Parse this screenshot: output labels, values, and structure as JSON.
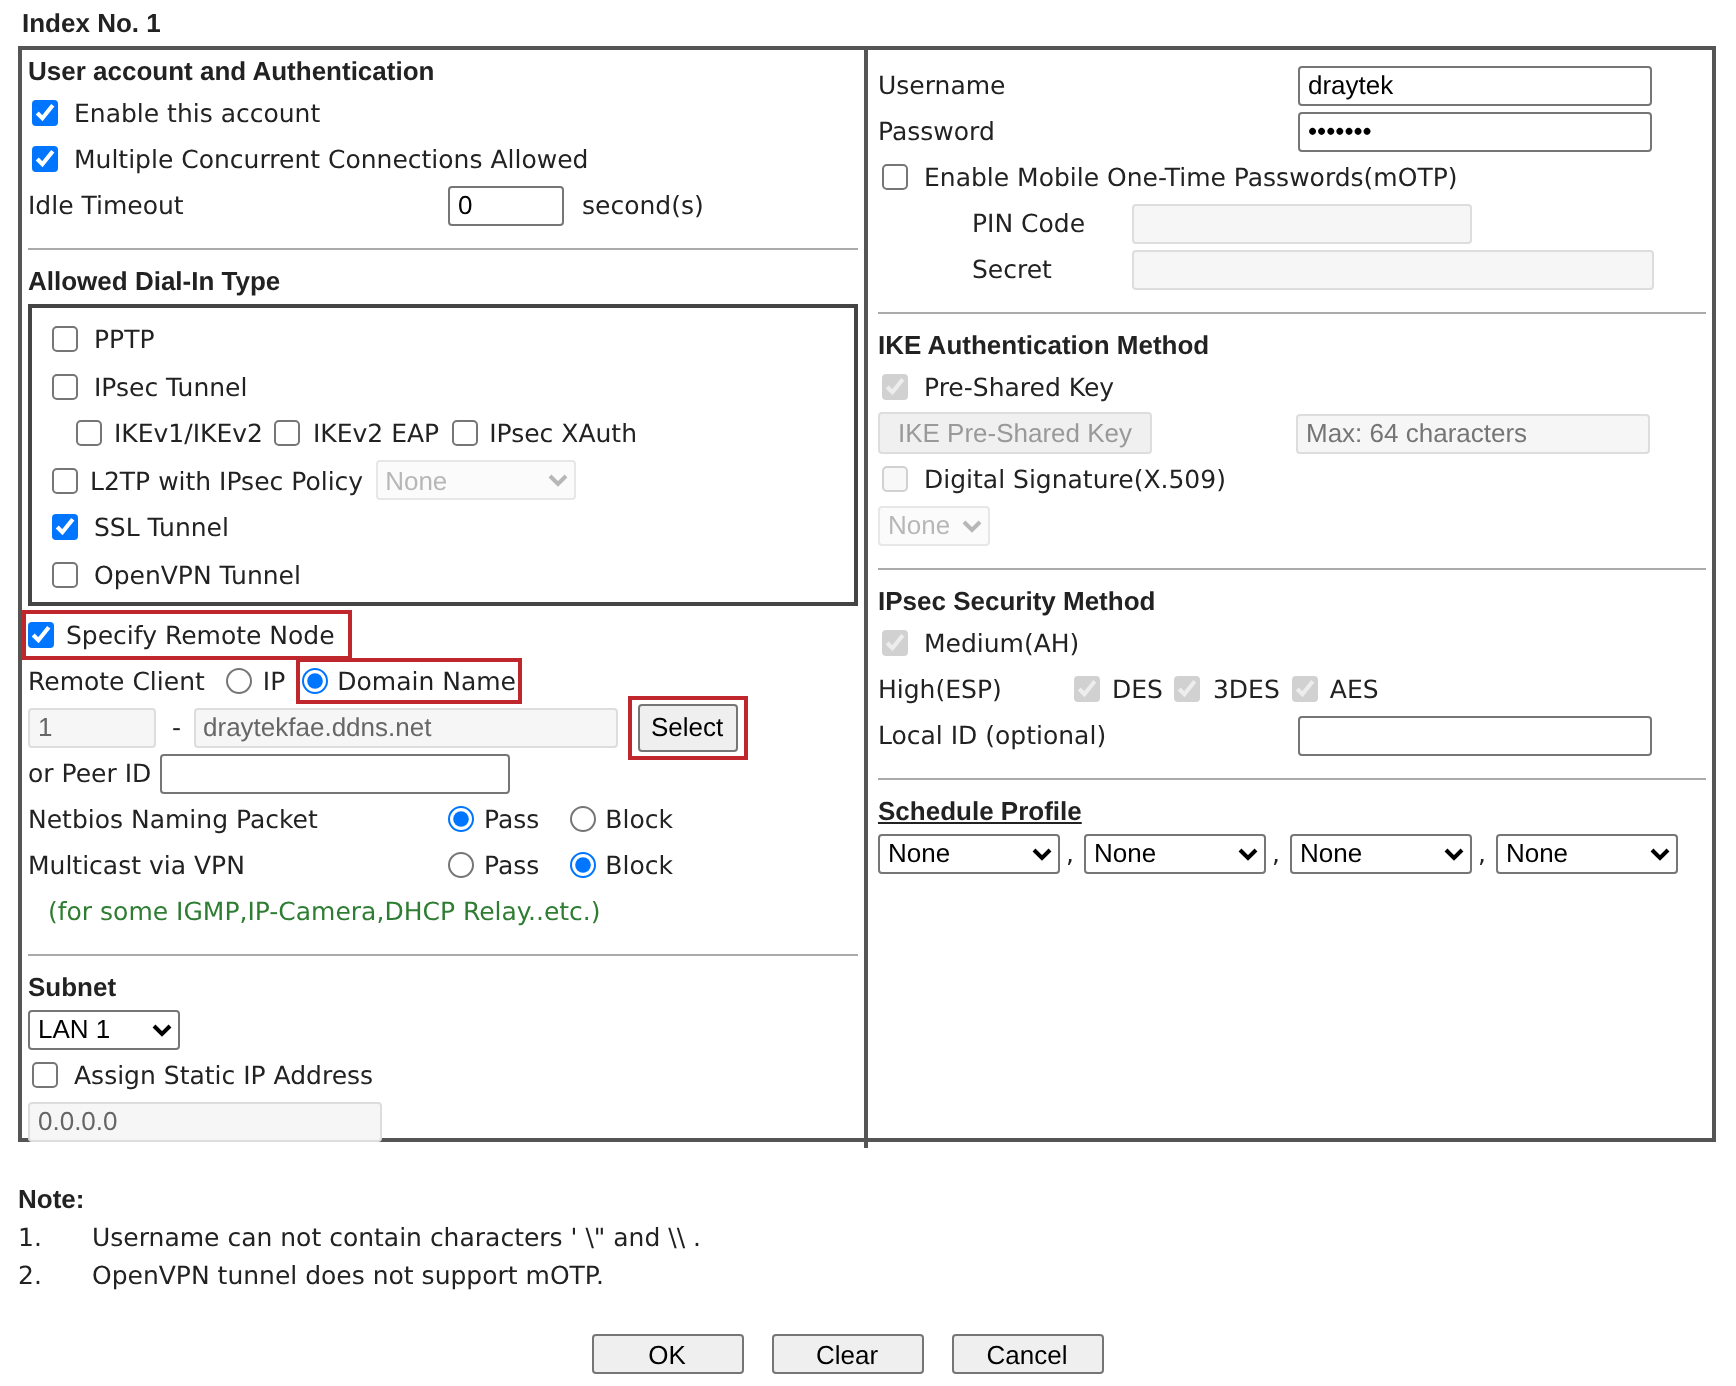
{
  "index_title": "Index No. 1",
  "account": {
    "heading": "User account and Authentication",
    "options": [
      {
        "label": "Enable this account",
        "checked": true
      },
      {
        "label": "Multiple Concurrent Connections Allowed",
        "checked": true
      }
    ],
    "idle_timeout": {
      "label": "Idle Timeout",
      "value": "0",
      "unit": "second(s)"
    }
  },
  "dial_in": {
    "heading": "Allowed Dial-In Type",
    "items": [
      {
        "kind": "check",
        "label": "PPTP",
        "checked": false
      },
      {
        "kind": "check",
        "label": "IPsec Tunnel",
        "checked": false
      },
      {
        "kind": "subchecks",
        "options": [
          {
            "label": "IKEv1/IKEv2",
            "checked": false
          },
          {
            "label": "IKEv2 EAP",
            "checked": false
          },
          {
            "label": "IPsec XAuth",
            "checked": false
          }
        ]
      },
      {
        "kind": "check_select",
        "label": "L2TP with IPsec Policy",
        "checked": false,
        "select": "None",
        "disabled": true
      },
      {
        "kind": "check",
        "label": "SSL Tunnel",
        "checked": true
      },
      {
        "kind": "check",
        "label": "OpenVPN Tunnel",
        "checked": false
      }
    ]
  },
  "remote_node": {
    "label": "Specify Remote Node",
    "checked": true,
    "highlighted": true
  },
  "remote_client": {
    "label": "Remote Client",
    "options": [
      {
        "label": "IP",
        "selected": false,
        "highlighted": false
      },
      {
        "label": "Domain Name",
        "selected": true,
        "highlighted": true
      }
    ],
    "index_value": "1",
    "separator": "-",
    "domain_value": "draytekfae.ddns.net",
    "select_button": {
      "label": "Select",
      "highlighted": true
    }
  },
  "peer_id": {
    "label": "or Peer ID"
  },
  "radio_rows": [
    {
      "label": "Netbios Naming Packet",
      "options": [
        {
          "label": "Pass",
          "selected": true
        },
        {
          "label": "Block",
          "selected": false
        }
      ]
    },
    {
      "label": "Multicast via VPN",
      "options": [
        {
          "label": "Pass",
          "selected": false
        },
        {
          "label": "Block",
          "selected": true
        }
      ]
    }
  ],
  "multicast_hint": "(for some IGMP,IP-Camera,DHCP Relay..etc.)",
  "subnet": {
    "heading": "Subnet",
    "select": "LAN 1",
    "static_ip": {
      "label": "Assign Static IP Address",
      "checked": false
    },
    "ip_value": "0.0.0.0"
  },
  "credentials": [
    {
      "label": "Username",
      "value": "draytek"
    },
    {
      "label": "Password",
      "value": "•••••••"
    }
  ],
  "motp": {
    "label": "Enable Mobile One-Time Passwords(mOTP)",
    "checked": false,
    "fields": [
      {
        "label": "PIN Code",
        "kind": "short"
      },
      {
        "label": "Secret",
        "kind": "long"
      }
    ]
  },
  "ike": {
    "heading": "IKE Authentication Method",
    "psk": {
      "label": "Pre-Shared Key",
      "checked": true,
      "disabled": true
    },
    "psk_button": "IKE Pre-Shared Key",
    "psk_placeholder": "Max: 64 characters",
    "signature": {
      "label": "Digital Signature(X.509)",
      "checked": false,
      "disabled": true
    },
    "signature_select": "None"
  },
  "ipsec": {
    "heading": "IPsec Security Method",
    "medium": {
      "label": "Medium(AH)",
      "checked": true,
      "disabled": true
    },
    "high_label": "High(ESP)",
    "high_options": [
      {
        "label": "DES",
        "checked": true,
        "disabled": true
      },
      {
        "label": "3DES",
        "checked": true,
        "disabled": true
      },
      {
        "label": "AES",
        "checked": true,
        "disabled": true
      }
    ],
    "local_id": {
      "label": "Local ID (optional)"
    }
  },
  "schedule": {
    "heading": "Schedule Profile",
    "selects": [
      {
        "value": "None",
        "separator": ","
      },
      {
        "value": "None",
        "separator": ","
      },
      {
        "value": "None",
        "separator": ","
      },
      {
        "value": "None"
      }
    ]
  },
  "notes": {
    "heading": "Note:",
    "items": [
      {
        "number": "1.",
        "text": "Username can not contain characters ' \\\" and \\\\ ."
      },
      {
        "number": "2.",
        "text": "OpenVPN tunnel does not support mOTP."
      }
    ]
  },
  "buttons": [
    "OK",
    "Clear",
    "Cancel"
  ]
}
